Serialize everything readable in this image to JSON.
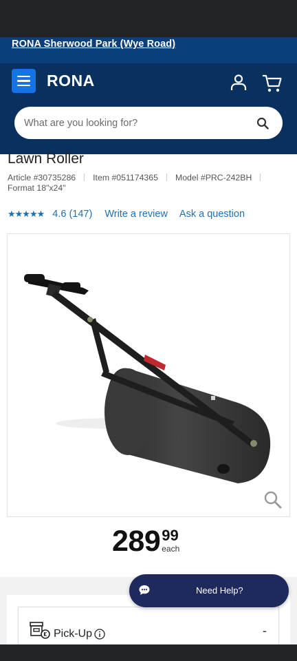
{
  "store": {
    "name": "RONA Sherwood Park (Wye Road)"
  },
  "header": {
    "logo": "RONA"
  },
  "search": {
    "placeholder": "What are you looking for?"
  },
  "product": {
    "title": "Lawn Roller",
    "article": "Article #30735286",
    "item": "Item #051174365",
    "model": "Model #PRC-242BH",
    "format": "Format 18\"x24\"",
    "rating_stars": "★★★★★",
    "rating": 4.6,
    "rating_label": "4.6 (147)",
    "write_review": "Write a review",
    "ask_question": "Ask a question"
  },
  "price": {
    "dollars": "289",
    "cents": "99",
    "unit": "each"
  },
  "fulfillment": {
    "pickup_label": "Pick-Up",
    "collapse_symbol": "-"
  },
  "chat": {
    "label": "Need Help?"
  },
  "icons": [
    "menu-icon",
    "account-icon",
    "cart-icon",
    "search-icon",
    "star-icon",
    "zoom-icon",
    "store-icon",
    "info-icon",
    "chat-icon"
  ],
  "colors": {
    "brand_dark": "#08315f",
    "store_bar": "#0b3f7c",
    "menu_button": "#1673e6",
    "link": "#1c6fb5",
    "chat_button": "#1f2a5c"
  }
}
